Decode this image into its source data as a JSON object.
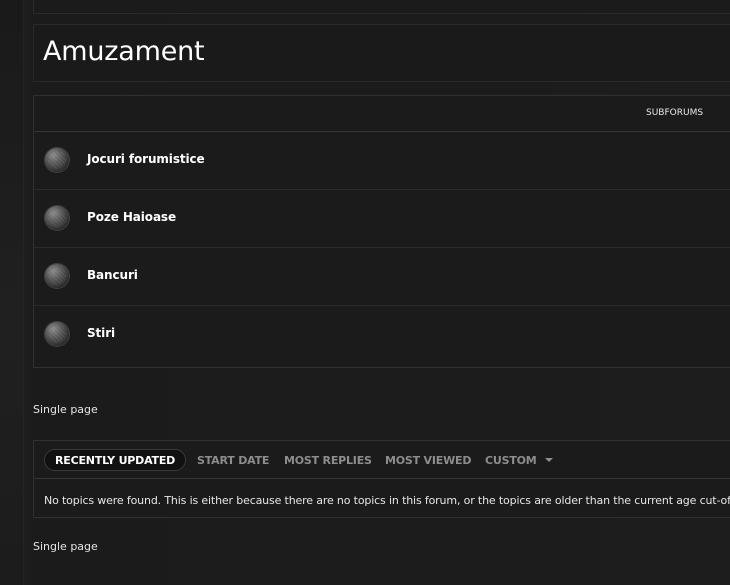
{
  "page": {
    "title": "Amuzament"
  },
  "forum_table": {
    "subforums_header": "SUBFORUMS",
    "forums": [
      {
        "name": "Jocuri forumistice"
      },
      {
        "name": "Poze Haioase"
      },
      {
        "name": "Bancuri"
      },
      {
        "name": "Stiri"
      }
    ]
  },
  "pagination": {
    "top_label": "Single page",
    "bottom_label": "Single page"
  },
  "topics": {
    "tabs": [
      {
        "label": "RECENTLY UPDATED",
        "active": true
      },
      {
        "label": "START DATE",
        "active": false
      },
      {
        "label": "MOST REPLIES",
        "active": false
      },
      {
        "label": "MOST VIEWED",
        "active": false
      },
      {
        "label": "CUSTOM",
        "active": false,
        "icon": "chevron-down-icon"
      }
    ],
    "empty_message": "No topics were found. This is either because there are no topics in this forum, or the topics are older than the current age cut-off."
  },
  "colors": {
    "background": "#1d1d1d",
    "panel": "#1b1b1b",
    "border": "#303030",
    "text": "#ffffff",
    "muted_tab": "#8d8d8d"
  }
}
